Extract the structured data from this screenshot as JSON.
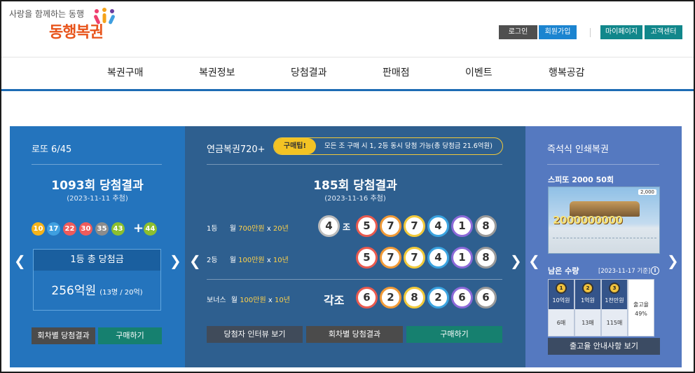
{
  "header": {
    "tagline": "사랑을 함께하는 동행",
    "brand": "동행복권",
    "buttons": {
      "login": "로그인",
      "join": "회원가입",
      "mypage": "마이페이지",
      "support": "고객센터"
    }
  },
  "nav": [
    "복권구매",
    "복권정보",
    "당첨결과",
    "판매점",
    "이벤트",
    "행복공감"
  ],
  "lotto": {
    "title": "로또 6/45",
    "draw_title": "1093회 당첨결과",
    "draw_date": "(2023-11-11 추첨)",
    "numbers": [
      10,
      17,
      22,
      30,
      35,
      43
    ],
    "plus": "+",
    "bonus": 44,
    "ball_colors": [
      "#f5b31a",
      "#3f9fe0",
      "#ef5b5b",
      "#ef5b5b",
      "#8c8c8c",
      "#8cbf2e",
      "#8cbf2e"
    ],
    "prize_label": "1등 총 당첨금",
    "prize_amount": "256억원",
    "prize_detail": "(13명 / 20억)",
    "btn_history": "회차별 당첨결과",
    "btn_buy": "구매하기"
  },
  "pension": {
    "title": "연금복권720+",
    "tip_label": "구매팁!",
    "tip_text": "모든 조 구매 시 1, 2등 동시 당첨 가능(총 당첨금 21.6억원)",
    "draw_title": "185회 당첨결과",
    "draw_date": "(2023-11-16 추첨)",
    "rank1": {
      "label": "1등",
      "prefix": "월 ",
      "amount": "700만원",
      "mid": " x ",
      "years": "20년"
    },
    "rank2": {
      "label": "2등",
      "prefix": "월 ",
      "amount": "100만원",
      "mid": " x ",
      "years": "10년"
    },
    "bonus": {
      "label": "보너스",
      "prefix": "월 ",
      "amount": "100만원",
      "mid": " x ",
      "years": "10년"
    },
    "group": "4",
    "group_suffix": "조",
    "group_all": "각조",
    "numbers_main": [
      5,
      7,
      7,
      4,
      1,
      8
    ],
    "numbers_bonus": [
      6,
      2,
      8,
      2,
      6,
      6
    ],
    "ring_colors": [
      "#e95a4f",
      "#f09a37",
      "#f1c93a",
      "#3aa3e0",
      "#8c6ad8",
      "#9a9a9a"
    ],
    "btn_interview": "당첨자 인터뷰 보기",
    "btn_history": "회차별 당첨결과",
    "btn_buy": "구매하기"
  },
  "instant": {
    "title": "즉석식 인쇄복권",
    "product": "스피또 2000 50회",
    "ticket_amount": "2000000000",
    "ticket_price": "2,000",
    "remain_label": "남은 수량",
    "remain_date": "[2023-11-17 기준]",
    "tiers": [
      {
        "medal": "1등",
        "label": "10억원",
        "count": "6매"
      },
      {
        "medal": "2등",
        "label": "1억원",
        "count": "13매"
      },
      {
        "medal": "3등",
        "label": "1천만원",
        "count": "115매"
      }
    ],
    "rate_label": "출고율",
    "rate_value": "49%",
    "btn_notice": "출고율 안내사항 보기"
  }
}
